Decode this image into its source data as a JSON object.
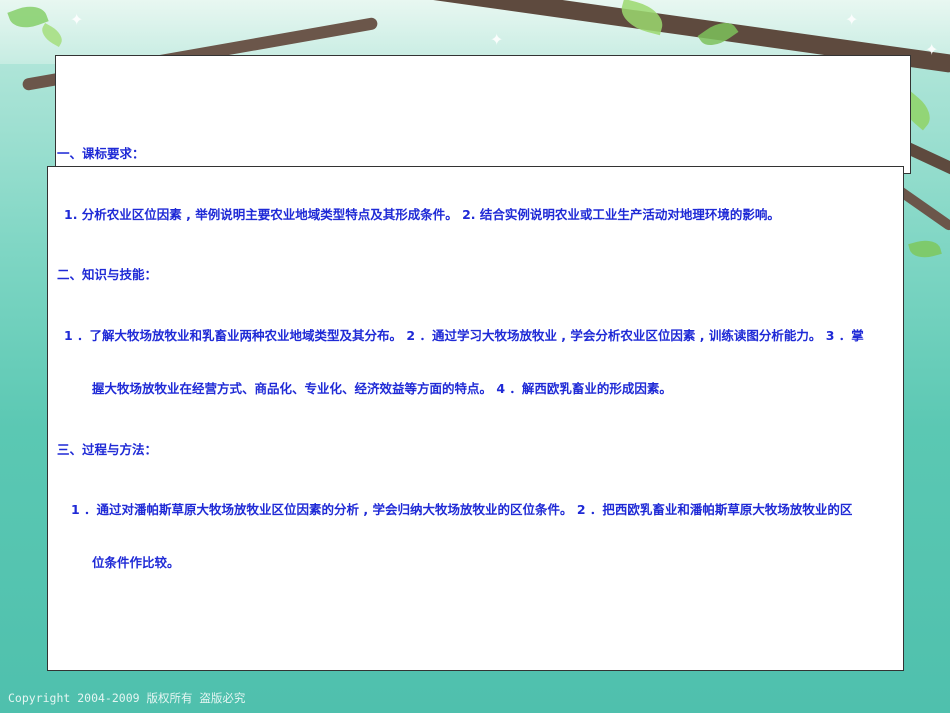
{
  "sections": {
    "s1_heading": "一、课标要求：",
    "s1_body_line1": "1. 分析农业区位因素 , 举例说明主要农业地域类型特点及其形成条件。 2. 结合实例说明农业或工业生产活动对地理环境的影响。",
    "s2_heading": "二、知识与技能：",
    "s2_body_line1": "1 ．了解大牧场放牧业和乳畜业两种农业地域类型及其分布。 2 ．通过学习大牧场放牧业 , 学会分析农业区位因素 , 训练读图分析能力。 3 ．掌",
    "s2_body_line2": "握大牧场放牧业在经营方式、商品化、专业化、经济效益等方面的特点。 4 ．解西欧乳畜业的形成因素。",
    "s3_heading": "三、过程与方法：",
    "s3_body_line1": "1 ．通过对潘帕斯草原大牧场放牧业区位因素的分析 , 学会归纳大牧场放牧业的区位条件。 2 ．把西欧乳畜业和潘帕斯草原大牧场放牧业的区",
    "s3_body_line2": "位条件作比较。"
  },
  "footer": {
    "copyright": "Copyright 2004-2009 版权所有 盗版必究"
  },
  "colors": {
    "text": "#1f2ad6",
    "panel_bg": "#ffffff",
    "background": "#5bc8b3"
  },
  "decorations": {
    "sparkle_icon": "star-sparkle",
    "leaf_icon": "leaf",
    "branch_icon": "tree-branch"
  }
}
